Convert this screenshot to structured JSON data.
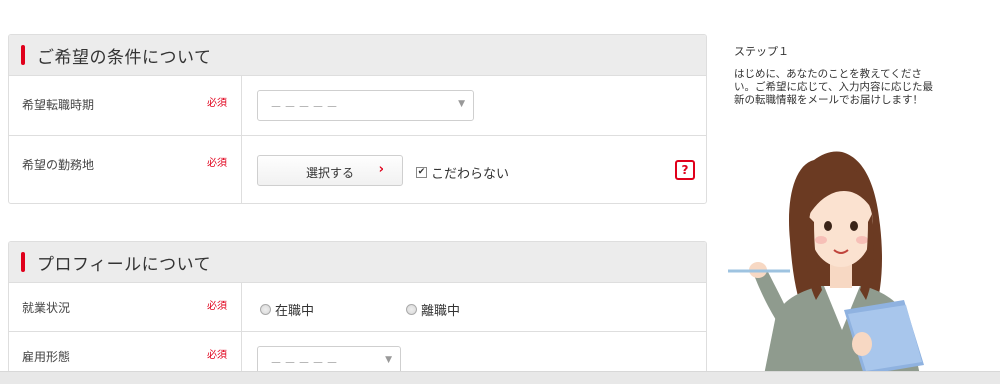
{
  "sections": [
    {
      "title": "ご希望の条件について",
      "rows": [
        {
          "label": "希望転職時期",
          "required": "必須",
          "placeholder": "－－－－－"
        },
        {
          "label": "希望の勤務地",
          "required": "必須",
          "button_label": "選択する",
          "button_arrow": "›",
          "checkbox_label": "こだわらない",
          "help": "?"
        }
      ]
    },
    {
      "title": "プロフィールについて",
      "rows": [
        {
          "label": "就業状況",
          "required": "必須",
          "options": [
            "在職中",
            "離職中"
          ]
        },
        {
          "label": "雇用形態",
          "required": "必須",
          "placeholder": "－－－－－"
        }
      ]
    }
  ],
  "sidebar": {
    "step_label": "ステップ１",
    "text": "はじめに、あなたのことを教えてください。ご希望に応じて、入力内容に応じた最新の転職情報をメールでお届けします！"
  },
  "colors": {
    "accent": "#e0001b",
    "header_bg": "#ececec",
    "border": "#dedede"
  },
  "icons": {
    "caret": "▼",
    "check": "✔"
  }
}
